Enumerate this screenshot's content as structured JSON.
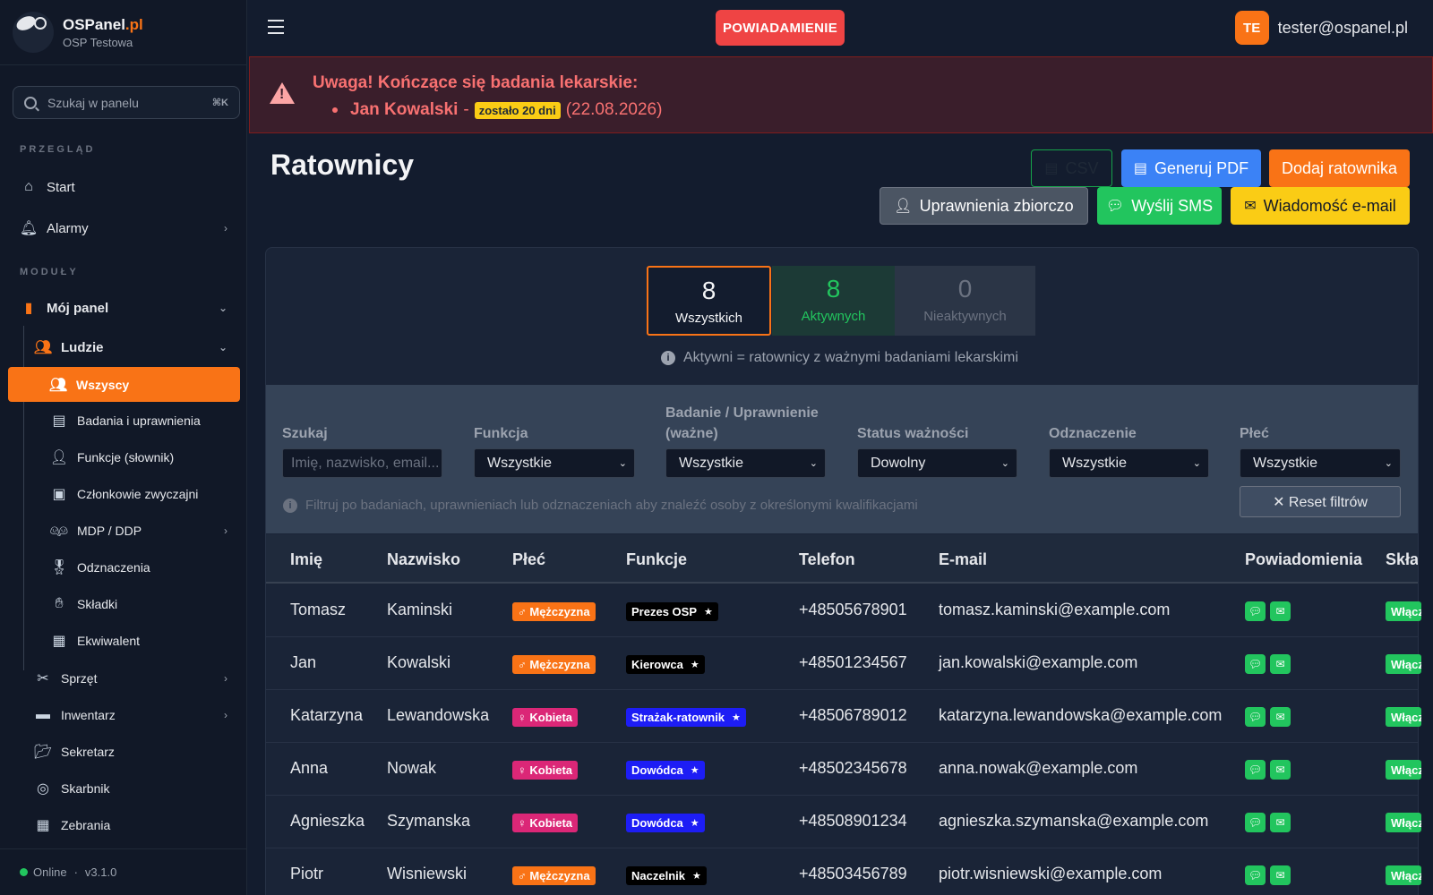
{
  "brand": {
    "name": "OSPanel",
    "tld": ".pl",
    "sub": "OSP Testowa"
  },
  "search": {
    "placeholder": "Szukaj w panelu",
    "shortcut": "⌘K"
  },
  "sections": {
    "overview": "PRZEGLĄD",
    "modules": "MODUŁY"
  },
  "nav": {
    "start": "Start",
    "alarms": "Alarmy",
    "my_panel": "Mój panel",
    "people": "Ludzie",
    "all": "Wszyscy",
    "exams": "Badania i uprawnienia",
    "functions": "Funkcje (słownik)",
    "members": "Członkowie zwyczajni",
    "mdp": "MDP / DDP",
    "awards": "Odznaczenia",
    "fees": "Składki",
    "equivalent": "Ekwiwalent",
    "equipment": "Sprzęt",
    "inventory": "Inwentarz",
    "secretary": "Sekretarz",
    "treasurer": "Skarbnik",
    "meetings": "Zebrania"
  },
  "status": {
    "online": "Online",
    "sep": "·",
    "version": "v3.1.0"
  },
  "topbar": {
    "notification": "POWIADAMIENIE",
    "avatar": "TE",
    "email": "tester@ospanel.pl"
  },
  "alert": {
    "title": "Uwaga! Kończące się badania lekarskie:",
    "person": "Jan Kowalski",
    "dash": "-",
    "badge": "zostało 20 dni",
    "date": "(22.08.2026)"
  },
  "page": {
    "title": "Ratownicy"
  },
  "buttons": {
    "csv": "CSV",
    "pdf": "Generuj PDF",
    "add": "Dodaj ratownika",
    "permissions": "Uprawnienia zbiorczo",
    "sms": "Wyślij SMS",
    "email": "Wiadomość e-mail"
  },
  "stats": {
    "all": {
      "n": "8",
      "label": "Wszystkich"
    },
    "active": {
      "n": "8",
      "label": "Aktywnych"
    },
    "inactive": {
      "n": "0",
      "label": "Nieaktywnych"
    },
    "hint": "Aktywni = ratownicy z ważnymi badaniami lekarskimi"
  },
  "filters": {
    "search_label": "Szukaj",
    "search_placeholder": "Imię, nazwisko, email...",
    "function_label": "Funkcja",
    "function_value": "Wszystkie",
    "exam_label_1": "Badanie / Uprawnienie",
    "exam_label_2": "(ważne)",
    "exam_value": "Wszystkie",
    "validity_label": "Status ważności",
    "validity_value": "Dowolny",
    "award_label": "Odznaczenie",
    "award_value": "Wszystkie",
    "gender_label": "Płeć",
    "gender_value": "Wszystkie",
    "hint": "Filtruj po badaniach, uprawnieniach lub odznaczeniach aby znaleźć osoby z określonymi kwalifikacjami",
    "reset": "✕ Reset filtrów"
  },
  "table": {
    "headers": [
      "Imię",
      "Nazwisko",
      "Płeć",
      "Funkcje",
      "Telefon",
      "E-mail",
      "Powiadomienia",
      "Składki"
    ],
    "rows": [
      {
        "first": "Tomasz",
        "last": "Kaminski",
        "gender": "♂ Mężczyzna",
        "gcolor": "#f97316",
        "func": "Prezes OSP",
        "fcolor": "#000000",
        "phone": "+48505678901",
        "email": "tomasz.kaminski@example.com",
        "fee": "Włączone"
      },
      {
        "first": "Jan",
        "last": "Kowalski",
        "gender": "♂ Mężczyzna",
        "gcolor": "#f97316",
        "func": "Kierowca",
        "fcolor": "#000000",
        "phone": "+48501234567",
        "email": "jan.kowalski@example.com",
        "fee": "Włączone"
      },
      {
        "first": "Katarzyna",
        "last": "Lewandowska",
        "gender": "♀ Kobieta",
        "gcolor": "#db2777",
        "func": "Strażak-ratownik",
        "fcolor": "#1d1df5",
        "phone": "+48506789012",
        "email": "katarzyna.lewandowska@example.com",
        "fee": "Włączone"
      },
      {
        "first": "Anna",
        "last": "Nowak",
        "gender": "♀ Kobieta",
        "gcolor": "#db2777",
        "func": "Dowódca",
        "fcolor": "#1d1df5",
        "phone": "+48502345678",
        "email": "anna.nowak@example.com",
        "fee": "Włączone"
      },
      {
        "first": "Agnieszka",
        "last": "Szymanska",
        "gender": "♀ Kobieta",
        "gcolor": "#db2777",
        "func": "Dowódca",
        "fcolor": "#1d1df5",
        "phone": "+48508901234",
        "email": "agnieszka.szymanska@example.com",
        "fee": "Włączone"
      },
      {
        "first": "Piotr",
        "last": "Wisniewski",
        "gender": "♂ Mężczyzna",
        "gcolor": "#f97316",
        "func": "Naczelnik",
        "fcolor": "#000000",
        "phone": "+48503456789",
        "email": "piotr.wisniewski@example.com",
        "fee": "Włączone"
      }
    ]
  },
  "colors": {
    "accent": "#f97316",
    "danger": "#ef4444",
    "success": "#22c55e",
    "primary": "#3b82f6",
    "warning": "#facc15"
  }
}
